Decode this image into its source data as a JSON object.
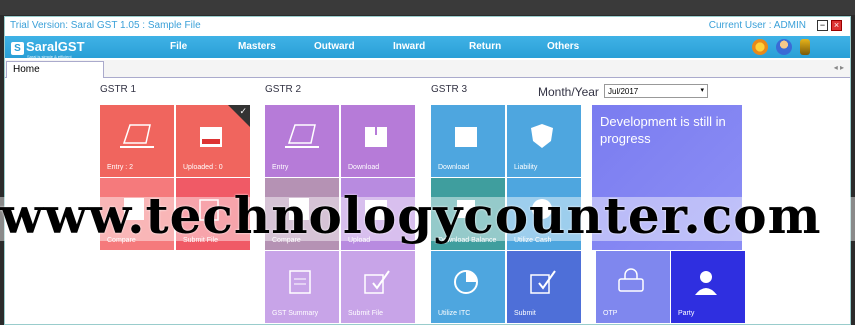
{
  "window": {
    "title": "Trial Version: Saral GST  1.05 : Sample File",
    "current_user": "Current User :  ADMIN",
    "minimize": "−",
    "close": "×"
  },
  "logo": {
    "badge": "S",
    "text": "SaralGST",
    "tagline": "Saral is simple & efficient"
  },
  "menu": {
    "items": [
      "File",
      "Masters",
      "Outward",
      "Inward",
      "Return",
      "Others"
    ]
  },
  "tabs": {
    "home": "Home",
    "arrows": "◂ ▸"
  },
  "sections": {
    "gstr1": "GSTR 1",
    "gstr2": "GSTR 2",
    "gstr3": "GSTR 3",
    "month_year_label": "Month/Year",
    "month_year_value": "Jul/2017"
  },
  "tiles": {
    "gstr1": {
      "entry": "Entry : 2",
      "uploaded": "Uploaded : 0",
      "compare": "Compare",
      "submit_file": "Submit File"
    },
    "gstr2": {
      "entry": "Entry",
      "download": "Download",
      "compare": "Compare",
      "upload": "Upload",
      "gst_summary": "GST Summary",
      "submit_file": "Submit File"
    },
    "gstr3": {
      "download": "Download",
      "liability": "Liability",
      "download_balance": "Download Balance",
      "utilize_cash": "Utilize Cash",
      "utilize_itc": "Utilize ITC",
      "submit": "Submit"
    },
    "dev": {
      "message": "Development is still in progress",
      "otp": "OTP",
      "party": "Party"
    }
  },
  "watermark": "www.technologycounter.com",
  "colors": {
    "gstr1_tile": "#f0605a",
    "gstr2_tile": "#b77ad6",
    "gstr3_tile": "#4fa6e0",
    "menu_bar": "#2a9fd6",
    "dev_tile": "#7a7cf0",
    "party_tile": "#2f2fe0"
  }
}
